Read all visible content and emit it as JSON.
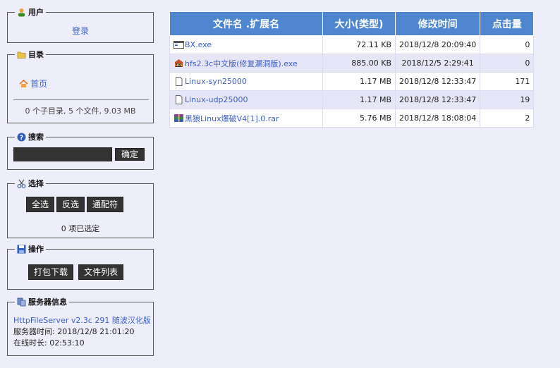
{
  "user_panel": {
    "title": "用户",
    "login_link": "登录"
  },
  "folder_panel": {
    "title": "目录",
    "home_link": "首页",
    "summary": "0 个子目录, 5 个文件, 9.03 MB"
  },
  "search_panel": {
    "title": "搜索",
    "input_value": "",
    "submit_label": "确定"
  },
  "select_panel": {
    "title": "选择",
    "select_all": "全选",
    "invert": "反选",
    "wildcard": "通配符",
    "selected_count": "0 项已选定"
  },
  "ops_panel": {
    "title": "操作",
    "archive_download": "打包下载",
    "file_list": "文件列表"
  },
  "server_panel": {
    "title": "服务器信息",
    "version_link": "HttpFileServer v2.3c 291 随波汉化版",
    "server_time": "服务器时间: 2018/12/8 21:01:20",
    "uptime": "在线时长: 02:53:10"
  },
  "table": {
    "headers": {
      "name": "文件名 .扩展名",
      "size": "大小(类型)",
      "modified": "修改时间",
      "hits": "点击量"
    },
    "rows": [
      {
        "icon": "exe-window-icon",
        "name": "BX.exe",
        "size": "72.11 KB",
        "modified": "2018/12/8 20:09:40",
        "hits": "0"
      },
      {
        "icon": "hfs-app-icon",
        "name": "hfs2.3c中文版(修复漏洞版).exe",
        "size": "885.00 KB",
        "modified": "2018/12/5 2:29:41",
        "hits": "0"
      },
      {
        "icon": "blank-file-icon",
        "name": "Linux-syn25000",
        "size": "1.17 MB",
        "modified": "2018/12/8 12:33:47",
        "hits": "171"
      },
      {
        "icon": "blank-file-icon",
        "name": "Linux-udp25000",
        "size": "1.17 MB",
        "modified": "2018/12/8 12:33:47",
        "hits": "19"
      },
      {
        "icon": "rar-archive-icon",
        "name": "黑狼Linux爆破V4[1].0.rar",
        "size": "5.76 MB",
        "modified": "2018/12/8 18:08:04",
        "hits": "2"
      }
    ]
  },
  "colors": {
    "header_bg": "#4e86cf",
    "link": "#3c5ec8",
    "page_bg": "#eeeefa",
    "button_bg": "#333333"
  }
}
